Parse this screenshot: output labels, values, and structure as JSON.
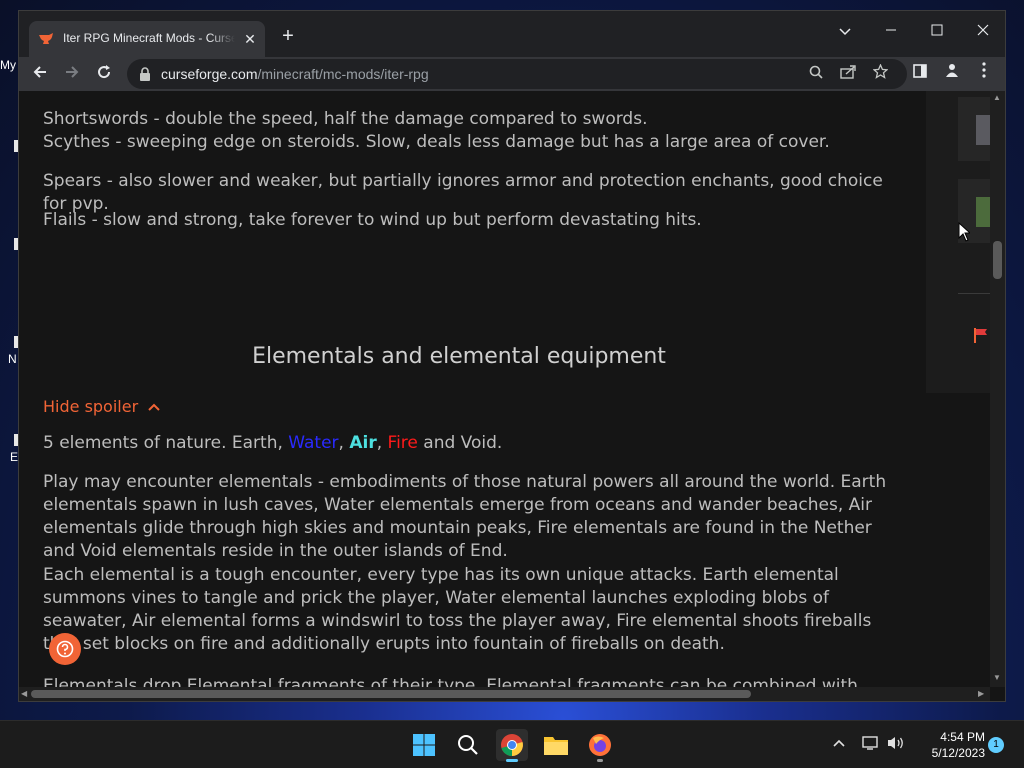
{
  "desktop": {
    "label_my": "My",
    "label_n": "N",
    "label_e": "E"
  },
  "browser": {
    "tab_title": "Iter RPG Minecraft Mods - CurseForge",
    "tab_close": "✕",
    "new_tab": "+",
    "url_host": "curseforge.com",
    "url_path": "/minecraft/mc-mods/iter-rpg"
  },
  "article": {
    "p1_line1": "Shortswords - double the speed, half the damage compared to swords.",
    "p1_line2": "Scythes - sweeping edge on steroids. Slow, deals less damage but has a large area of cover.",
    "p2": "Spears - also slower and weaker, but partially ignores armor and protection enchants, good choice for pvp.",
    "p3": "Flails - slow and strong, take forever to wind up but perform devastating hits.",
    "heading": "Elementals and elemental equipment",
    "spoiler_toggle": "Hide spoiler",
    "elements_prefix": "5 elements of nature. Earth, ",
    "element_water": "Water",
    "element_air": "Air",
    "element_fire": "Fire",
    "elements_suffix": " and Void.",
    "p5": "Play may encounter elementals - embodiments of those natural powers all around the world. Earth elementals spawn in lush caves, Water elementals emerge from oceans and wander beaches, Air elementals glide through high skies and mountain peaks, Fire elementals are found in the Nether and Void elementals reside in the outer islands of End.",
    "p6": "Each elemental is a tough encounter, every type has its own unique attacks. Earth elemental summons vines to tangle and prick the player, Water elemental launches exploding blobs of seawater, Air elemental forms a windswirl to toss the player away, Fire elemental shoots fireballs that set blocks on fire and additionally erupts into fountain of fireballs on death.",
    "p7": "Elementals drop Elemental fragments of their type. Elemental fragments can be combined with ametrine"
  },
  "taskbar": {
    "time": "4:54 PM",
    "date": "5/12/2023",
    "notifications": "1"
  },
  "colors": {
    "accent": "#f16436",
    "water": "#2a2aff",
    "air": "#4de0e0",
    "fire": "#ff1a1a"
  }
}
